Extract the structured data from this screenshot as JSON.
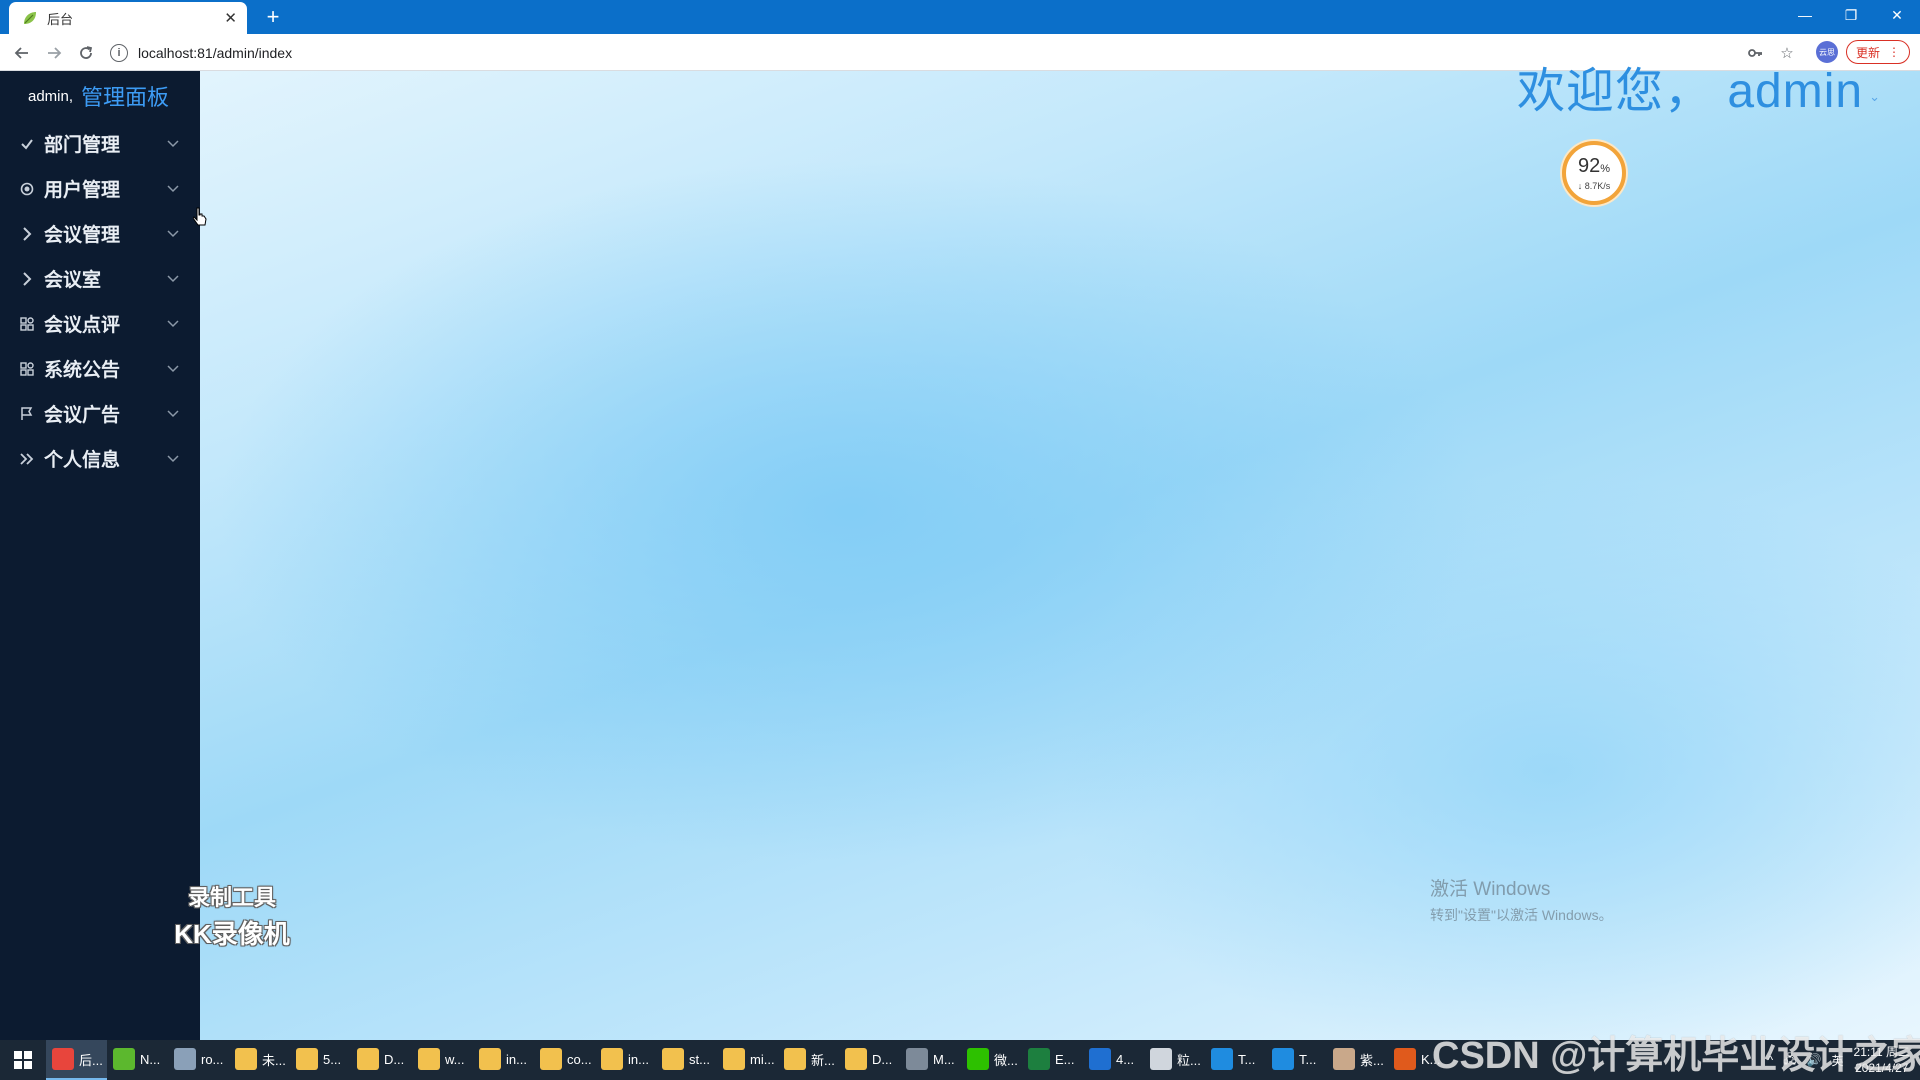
{
  "browser": {
    "tab_title": "后台",
    "url": "localhost:81/admin/index",
    "update_label": "更新",
    "profile_label": "云思"
  },
  "sidebar": {
    "user": "admin,",
    "panel_title": "管理面板",
    "items": [
      {
        "label": "部门管理",
        "icon": "check-icon"
      },
      {
        "label": "用户管理",
        "icon": "target-icon"
      },
      {
        "label": "会议管理",
        "icon": "chevron-right-icon"
      },
      {
        "label": "会议室",
        "icon": "chevron-right-icon"
      },
      {
        "label": "会议点评",
        "icon": "apps-icon"
      },
      {
        "label": "系统公告",
        "icon": "apps-icon"
      },
      {
        "label": "会议广告",
        "icon": "flag-icon"
      },
      {
        "label": "个人信息",
        "icon": "double-chevron-icon"
      }
    ]
  },
  "main": {
    "welcome": "欢迎您， admin"
  },
  "speed_widget": {
    "percent": "92",
    "percent_unit": "%",
    "rate": "↓ 8.7K/s"
  },
  "overlay": {
    "activate_title": "激活 Windows",
    "activate_sub": "转到\"设置\"以激活 Windows。",
    "rec_line1": "录制工具",
    "rec_line2": "KK录像机",
    "csdn": "CSDN @计算机毕业设计之家"
  },
  "taskbar": {
    "tasks": [
      {
        "label": "后...",
        "color": "#e8453c",
        "active": true
      },
      {
        "label": "N...",
        "color": "#5cb82e",
        "active": false
      },
      {
        "label": "ro...",
        "color": "#8aa0b8",
        "active": false
      },
      {
        "label": "未...",
        "color": "#f2c14e",
        "active": false
      },
      {
        "label": "5...",
        "color": "#f2c14e",
        "active": false
      },
      {
        "label": "D...",
        "color": "#f2c14e",
        "active": false
      },
      {
        "label": "w...",
        "color": "#f2c14e",
        "active": false
      },
      {
        "label": "in...",
        "color": "#f2c14e",
        "active": false
      },
      {
        "label": "co...",
        "color": "#f2c14e",
        "active": false
      },
      {
        "label": "in...",
        "color": "#f2c14e",
        "active": false
      },
      {
        "label": "st...",
        "color": "#f2c14e",
        "active": false
      },
      {
        "label": "mi...",
        "color": "#f2c14e",
        "active": false
      },
      {
        "label": "新...",
        "color": "#f2c14e",
        "active": false
      },
      {
        "label": "D...",
        "color": "#f2c14e",
        "active": false
      },
      {
        "label": "M...",
        "color": "#7d8a99",
        "active": false
      },
      {
        "label": "微...",
        "color": "#2dc100",
        "active": false
      },
      {
        "label": "E...",
        "color": "#1d7f3f",
        "active": false
      },
      {
        "label": "4...",
        "color": "#1f6fd1",
        "active": false
      },
      {
        "label": "粒...",
        "color": "#d0d6dd",
        "active": false
      },
      {
        "label": "T...",
        "color": "#1f8ce0",
        "active": false
      },
      {
        "label": "T...",
        "color": "#1f8ce0",
        "active": false
      },
      {
        "label": "紫...",
        "color": "#c9a88a",
        "active": false
      },
      {
        "label": "K...",
        "color": "#e05a1c",
        "active": false
      }
    ],
    "ime": "英",
    "time": "21:11 周二",
    "date": "2021/4/27"
  }
}
